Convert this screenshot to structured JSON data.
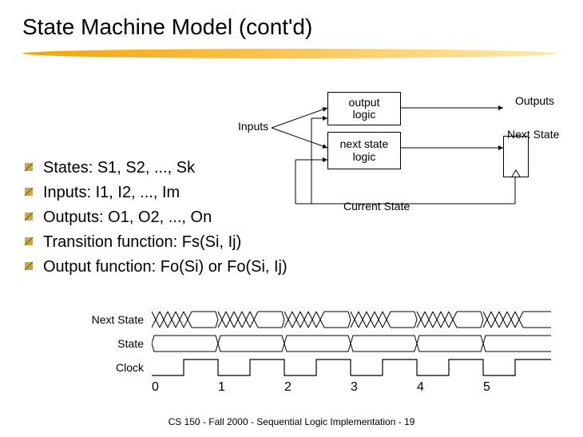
{
  "title": "State Machine Model (cont'd)",
  "diagram": {
    "inputs": "Inputs",
    "output_logic": "output\nlogic",
    "next_state_logic": "next state\nlogic",
    "outputs": "Outputs",
    "next_state": "Next State",
    "current_state": "Current State"
  },
  "bullets": [
    "States: S1, S2, ..., Sk",
    "Inputs: I1, I2, ..., Im",
    "Outputs: O1, O2, ..., On",
    "Transition function: Fs(Si, Ij)",
    "Output function: Fo(Si) or Fo(Si, Ij)"
  ],
  "timing": {
    "rows": [
      "Next State",
      "State",
      "Clock"
    ],
    "ticks": [
      "0",
      "1",
      "2",
      "3",
      "4",
      "5"
    ]
  },
  "footer": "CS 150 - Fall 2000 - Sequential Logic Implementation - 19"
}
